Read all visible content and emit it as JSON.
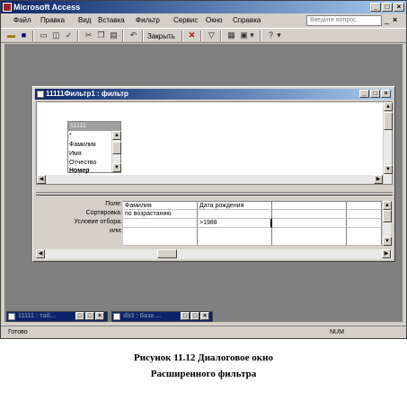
{
  "app": {
    "title": "Microsoft Access",
    "window_buttons": [
      "_",
      "□",
      "×"
    ]
  },
  "menu": {
    "items": [
      "Файл",
      "Правка",
      "Вид",
      "Вставка",
      "Фильтр",
      "Сервис",
      "Окно",
      "Справка"
    ],
    "help_placeholder": "Введите вопрос"
  },
  "toolbar": {
    "close_label": "Закрыть"
  },
  "filter_window": {
    "title": "11111Фильтр1 : фильтр",
    "table": {
      "name": "11111",
      "fields": [
        "*",
        "Фамилия",
        "Имя",
        "Отчество",
        "Номер"
      ]
    },
    "grid": {
      "row_labels": [
        "Поле:",
        "Сортировка:",
        "Условие отбора:",
        "или:"
      ],
      "columns": [
        {
          "field": "Фамилия",
          "sort": "по возрастанию",
          "criteria": "",
          "or": ""
        },
        {
          "field": "Дата рождения",
          "sort": "",
          "criteria": ">1988",
          "or": ""
        },
        {
          "field": "",
          "sort": "",
          "criteria": "",
          "or": ""
        },
        {
          "field": "",
          "sort": "",
          "criteria": "",
          "or": ""
        }
      ]
    }
  },
  "minimized": [
    {
      "title": "11111 : таб..."
    },
    {
      "title": "db3 : база ..."
    }
  ],
  "status": {
    "left": "Готово",
    "right": "NUM"
  },
  "caption": {
    "line1": "Рисунок  11.12 Диалоговое окно",
    "line2": "Расширенного фильтра"
  }
}
